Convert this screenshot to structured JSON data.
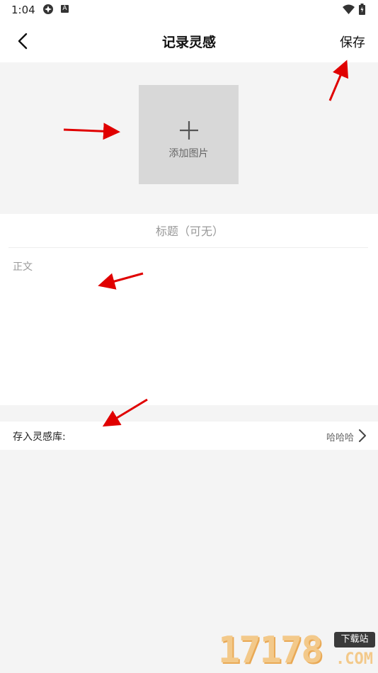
{
  "status_bar": {
    "time": "1:04",
    "icons": [
      "settings-icon",
      "a-badge-icon",
      "wifi-icon",
      "battery-icon"
    ]
  },
  "header": {
    "title": "记录灵感",
    "save_label": "保存",
    "back_icon": "chevron-left-icon"
  },
  "image_picker": {
    "label": "添加图片",
    "icon": "plus-icon"
  },
  "form": {
    "title_placeholder": "标题（可无）",
    "title_value": "",
    "body_placeholder": "正文",
    "body_value": ""
  },
  "library": {
    "label": "存入灵感库:",
    "value": "哈哈哈",
    "icon": "chevron-right-icon"
  },
  "watermark": {
    "digits": "17178",
    "badge": "下载站",
    "suffix": ".COM"
  },
  "colors": {
    "annotation_arrow": "#e00000",
    "page_background": "#f4f4f4",
    "image_box": "#d8d8d8"
  }
}
